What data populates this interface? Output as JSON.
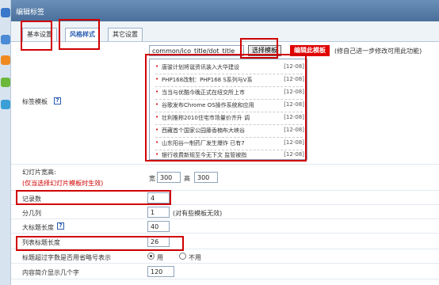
{
  "window": {
    "title": "编辑标签"
  },
  "tabs": [
    {
      "label": "基本设置"
    },
    {
      "label": "风格样式"
    },
    {
      "label": "其它设置"
    }
  ],
  "template": {
    "label": "标签模板",
    "path": "common/ico_title/dot_title",
    "select_button": "选择模板",
    "edit_button": "编辑此模板",
    "note": "(修自己进一步修改可用此功能)",
    "preview_items": [
      {
        "text": "唐骏计划将诞资讯装入大华建设",
        "date": "[12-08]"
      },
      {
        "text": "PHP168改制：PHP168 S系列与V系",
        "date": "[12-08]"
      },
      {
        "text": "当当与优酷今晚正式在纽交所上市",
        "date": "[12-08]"
      },
      {
        "text": "谷歌发布Chrome OS操作系统和应用",
        "date": "[12-08]"
      },
      {
        "text": "壮利推称2010住宅市场量价齐升 调",
        "date": "[12-08]"
      },
      {
        "text": "西藏首个国家公园藤香楠布大峡谷",
        "date": "[12-08]"
      },
      {
        "text": "山东阳谷一制药厂发生爆炸 已有7",
        "date": "[12-08]"
      },
      {
        "text": "银行收费新规至今无下文 监管被指",
        "date": "[12-08]"
      }
    ]
  },
  "slide": {
    "label": "幻灯片宽高:",
    "note": "(仅当选择幻灯片模板时生效)",
    "width_label": "宽",
    "width": "300",
    "height_label": "高",
    "height": "300"
  },
  "records": {
    "label": "记录数",
    "value": "4"
  },
  "columns": {
    "label": "分几列",
    "value": "1",
    "note": "(对有些模板无效)"
  },
  "big_title": {
    "label": "大标题长度",
    "value": "40"
  },
  "list_title": {
    "label": "列表标题长度",
    "value": "26"
  },
  "overflow": {
    "label": "标题超过字数是否用省略号表示",
    "opt_yes": "用",
    "opt_no": "不用",
    "selected": "用"
  },
  "summary": {
    "label": "内容简介显示几个字",
    "value": "120"
  }
}
